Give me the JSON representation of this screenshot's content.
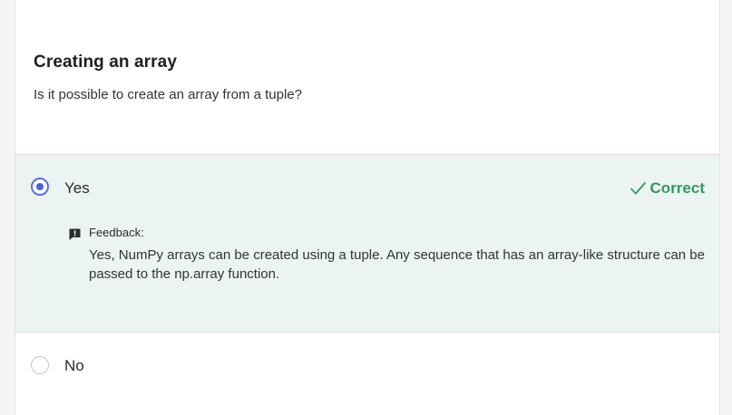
{
  "question": {
    "title": "Creating an array",
    "text": "Is it possible to create an array from a tuple?"
  },
  "options": [
    {
      "label": "Yes",
      "selected": true,
      "result": "Correct",
      "feedback_label": "Feedback:",
      "feedback_text": "Yes, NumPy arrays can be created using a tuple. Any sequence that has an array-like structure can be passed to the np.array function."
    },
    {
      "label": "No",
      "selected": false
    }
  ],
  "colors": {
    "accent": "#4a5fe0",
    "correct": "#2e9a60",
    "selected_bg": "#ecf4f1"
  },
  "icons": {
    "check": "check-icon",
    "feedback": "feedback-icon"
  }
}
